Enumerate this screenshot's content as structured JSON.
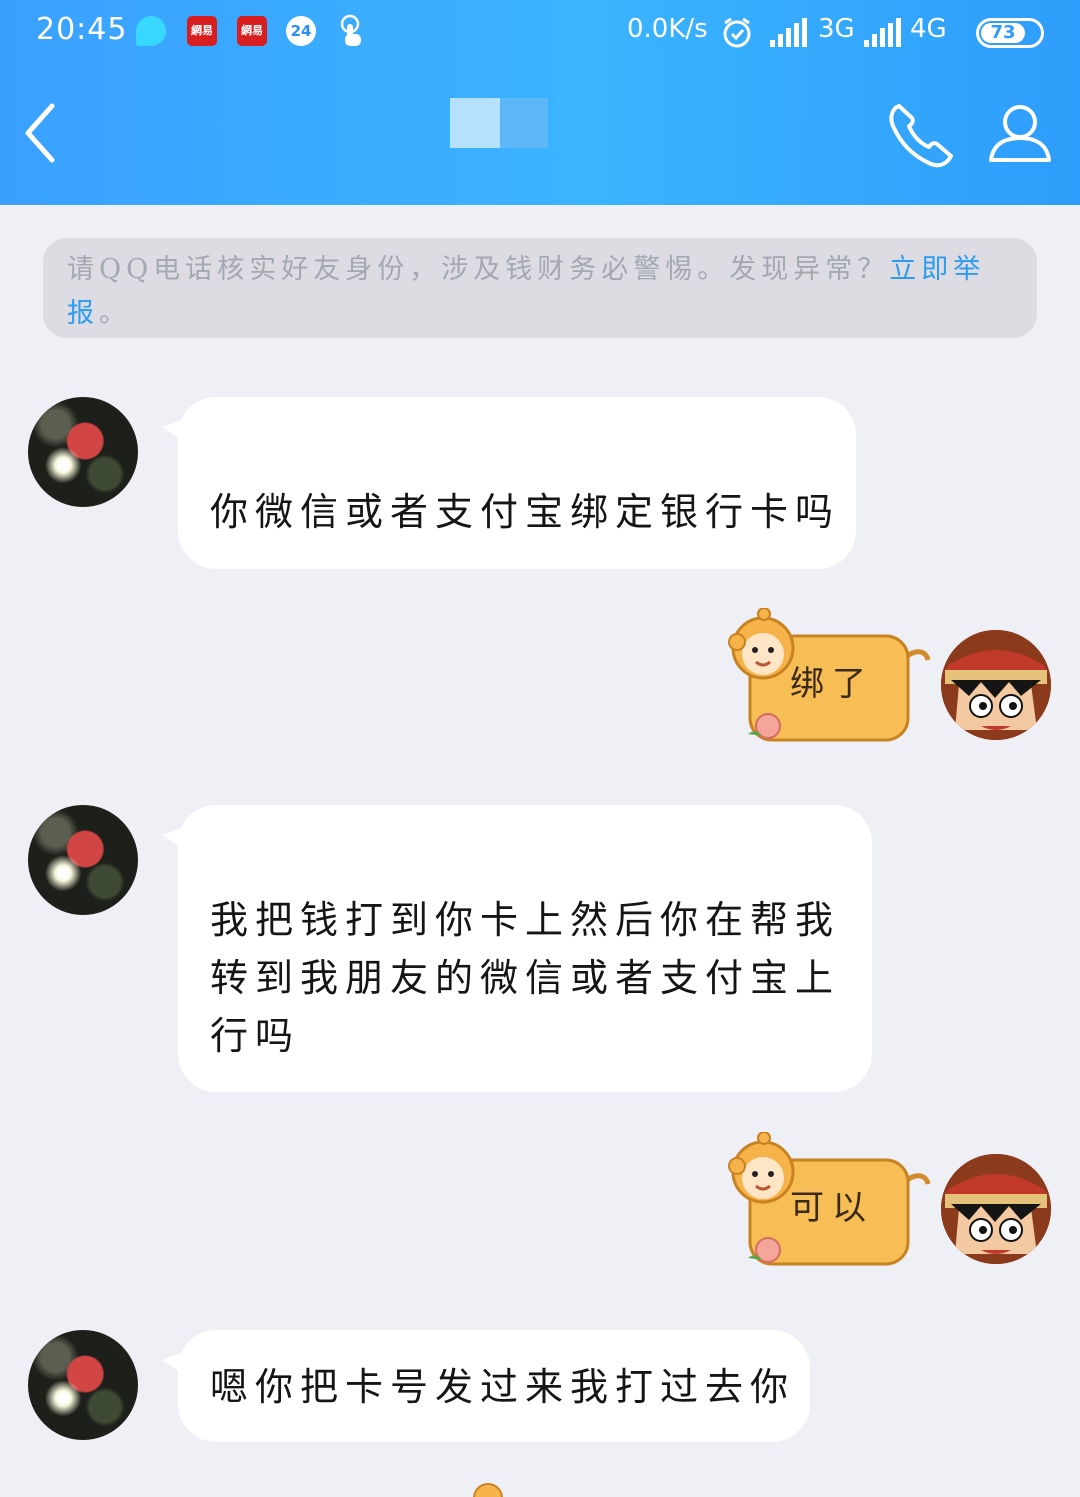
{
  "status_bar": {
    "time": "20:45",
    "icons": [
      "bubble-app-icon",
      "netease-icon",
      "netease-icon",
      "24h-icon",
      "touch-icon"
    ],
    "netease_label": "網易",
    "badge_24": "24",
    "net_speed": "0.0K/s",
    "signal_1": "3G",
    "signal_2": "4G",
    "battery": "73"
  },
  "nav": {
    "back_icon": "chevron-left-icon",
    "call_icon": "phone-icon",
    "profile_icon": "person-icon"
  },
  "notice": {
    "text": "请QQ电话核实好友身份，涉及钱财务必警惕。发现异常？",
    "link": "立即举报",
    "end": "。"
  },
  "messages": [
    {
      "side": "left",
      "text": "你微信或者支付宝绑定银行卡吗"
    },
    {
      "side": "right",
      "sticker": "monkey-sticker",
      "text": "绑了"
    },
    {
      "side": "left",
      "lines": [
        "我把钱打到你卡上然后你在帮我",
        "转到我朋友的微信或者支付宝上",
        "行吗"
      ]
    },
    {
      "side": "right",
      "sticker": "monkey-sticker",
      "text": "可以"
    },
    {
      "side": "left",
      "text": "嗯你把卡号发过来我打过去你"
    }
  ],
  "colors": {
    "header_blue": "#3aa0ff",
    "chat_bg": "#eff0f5",
    "notice_bg": "#dcdce2",
    "link_blue": "#2c9cf0",
    "sticker_orange": "#f7be55"
  }
}
